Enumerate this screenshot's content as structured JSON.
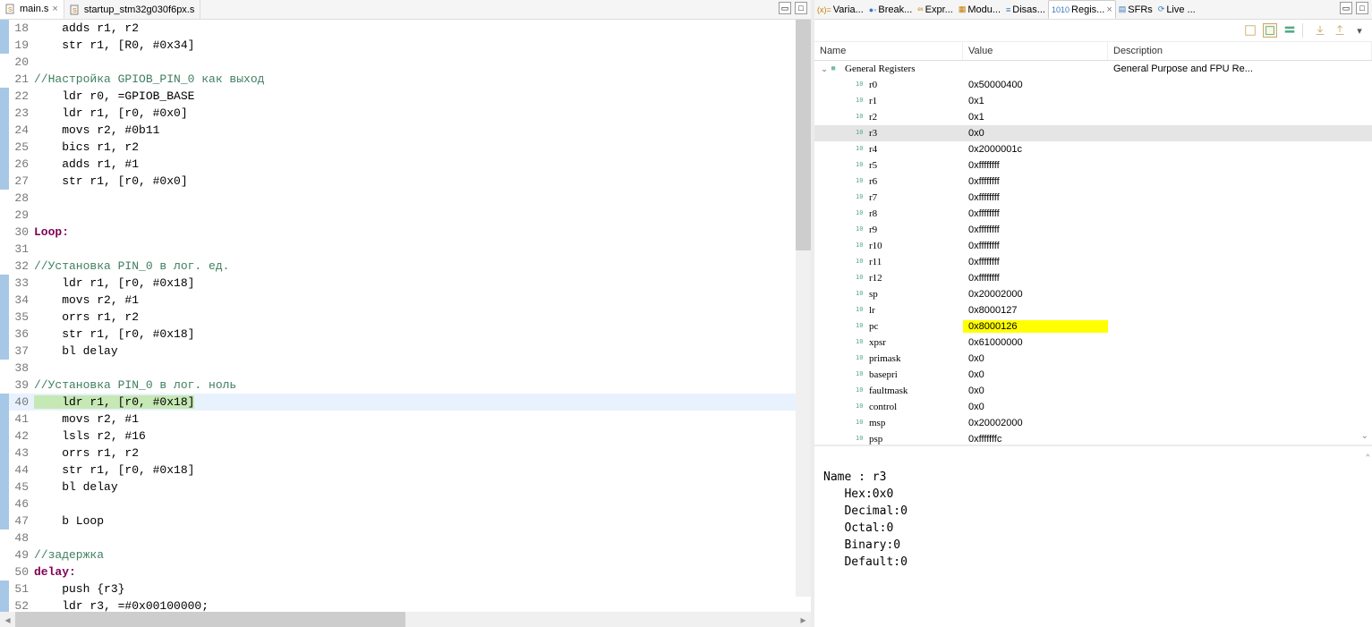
{
  "editor": {
    "tabs": [
      {
        "label": "main.s",
        "active": true
      },
      {
        "label": "startup_stm32g030f6px.s",
        "active": false
      }
    ],
    "lines": [
      {
        "n": 18,
        "bar": true,
        "type": "code",
        "text": "    adds r1, r2"
      },
      {
        "n": 19,
        "bar": true,
        "type": "code",
        "text": "    str r1, [R0, #0x34]"
      },
      {
        "n": 20,
        "bar": false,
        "type": "blank",
        "text": ""
      },
      {
        "n": 21,
        "bar": false,
        "type": "comment",
        "text": "//Настройка GPIOB_PIN_0 как выход"
      },
      {
        "n": 22,
        "bar": true,
        "type": "code",
        "text": "    ldr r0, =GPIOB_BASE"
      },
      {
        "n": 23,
        "bar": true,
        "type": "code",
        "text": "    ldr r1, [r0, #0x0]"
      },
      {
        "n": 24,
        "bar": true,
        "type": "code",
        "text": "    movs r2, #0b11"
      },
      {
        "n": 25,
        "bar": true,
        "type": "code",
        "text": "    bics r1, r2"
      },
      {
        "n": 26,
        "bar": true,
        "type": "code",
        "text": "    adds r1, #1"
      },
      {
        "n": 27,
        "bar": true,
        "type": "code",
        "text": "    str r1, [r0, #0x0]"
      },
      {
        "n": 28,
        "bar": false,
        "type": "blank",
        "text": ""
      },
      {
        "n": 29,
        "bar": false,
        "type": "blank",
        "text": ""
      },
      {
        "n": 30,
        "bar": false,
        "type": "label",
        "text": "Loop:"
      },
      {
        "n": 31,
        "bar": false,
        "type": "blank",
        "text": ""
      },
      {
        "n": 32,
        "bar": false,
        "type": "comment",
        "text": "//Установка PIN_0 в лог. ед."
      },
      {
        "n": 33,
        "bar": true,
        "type": "code",
        "text": "    ldr r1, [r0, #0x18]"
      },
      {
        "n": 34,
        "bar": true,
        "type": "code",
        "text": "    movs r2, #1"
      },
      {
        "n": 35,
        "bar": true,
        "type": "code",
        "text": "    orrs r1, r2"
      },
      {
        "n": 36,
        "bar": true,
        "type": "code",
        "text": "    str r1, [r0, #0x18]"
      },
      {
        "n": 37,
        "bar": true,
        "type": "code",
        "text": "    bl delay"
      },
      {
        "n": 38,
        "bar": false,
        "type": "blank",
        "text": ""
      },
      {
        "n": 39,
        "bar": false,
        "type": "comment",
        "text": "//Установка PIN_0 в лог. ноль"
      },
      {
        "n": 40,
        "bar": true,
        "type": "code",
        "text": "    ldr r1, [r0, #0x18]",
        "current": true
      },
      {
        "n": 41,
        "bar": true,
        "type": "code",
        "text": "    movs r2, #1"
      },
      {
        "n": 42,
        "bar": true,
        "type": "code",
        "text": "    lsls r2, #16"
      },
      {
        "n": 43,
        "bar": true,
        "type": "code",
        "text": "    orrs r1, r2"
      },
      {
        "n": 44,
        "bar": true,
        "type": "code",
        "text": "    str r1, [r0, #0x18]"
      },
      {
        "n": 45,
        "bar": true,
        "type": "code",
        "text": "    bl delay"
      },
      {
        "n": 46,
        "bar": true,
        "type": "blank",
        "text": ""
      },
      {
        "n": 47,
        "bar": true,
        "type": "code",
        "text": "    b Loop"
      },
      {
        "n": 48,
        "bar": false,
        "type": "blank",
        "text": ""
      },
      {
        "n": 49,
        "bar": false,
        "type": "comment",
        "text": "//задержка"
      },
      {
        "n": 50,
        "bar": false,
        "type": "label",
        "text": "delay:"
      },
      {
        "n": 51,
        "bar": true,
        "type": "code",
        "text": "    push {r3}"
      },
      {
        "n": 52,
        "bar": true,
        "type": "code",
        "text": "    ldr r3, =#0x00100000;"
      }
    ]
  },
  "views": {
    "tabs": [
      {
        "label": "Varia...",
        "icon": "var",
        "color": "#c77d00"
      },
      {
        "label": "Break...",
        "icon": "brk",
        "color": "#3a7abd"
      },
      {
        "label": "Expr...",
        "icon": "expr",
        "color": "#c77d00"
      },
      {
        "label": "Modu...",
        "icon": "mod",
        "color": "#c77d00"
      },
      {
        "label": "Disas...",
        "icon": "dis",
        "color": "#3a7abd"
      },
      {
        "label": "Regis...",
        "icon": "reg",
        "color": "#3a7abd",
        "active": true
      },
      {
        "label": "SFRs",
        "icon": "sfr",
        "color": "#3a7abd"
      },
      {
        "label": "Live ...",
        "icon": "live",
        "color": "#3a7abd"
      }
    ]
  },
  "registers": {
    "headers": {
      "name": "Name",
      "value": "Value",
      "desc": "Description"
    },
    "group": {
      "label": "General Registers",
      "desc": "General Purpose and FPU Re..."
    },
    "rows": [
      {
        "name": "r0",
        "value": "0x50000400"
      },
      {
        "name": "r1",
        "value": "0x1"
      },
      {
        "name": "r2",
        "value": "0x1"
      },
      {
        "name": "r3",
        "value": "0x0",
        "selected": true
      },
      {
        "name": "r4",
        "value": "0x2000001c"
      },
      {
        "name": "r5",
        "value": "0xffffffff"
      },
      {
        "name": "r6",
        "value": "0xffffffff"
      },
      {
        "name": "r7",
        "value": "0xffffffff"
      },
      {
        "name": "r8",
        "value": "0xffffffff"
      },
      {
        "name": "r9",
        "value": "0xffffffff"
      },
      {
        "name": "r10",
        "value": "0xffffffff"
      },
      {
        "name": "r11",
        "value": "0xffffffff"
      },
      {
        "name": "r12",
        "value": "0xffffffff"
      },
      {
        "name": "sp",
        "value": "0x20002000"
      },
      {
        "name": "lr",
        "value": "0x8000127"
      },
      {
        "name": "pc",
        "value": "0x8000126",
        "highlight": true
      },
      {
        "name": "xpsr",
        "value": "0x61000000"
      },
      {
        "name": "primask",
        "value": "0x0"
      },
      {
        "name": "basepri",
        "value": "0x0"
      },
      {
        "name": "faultmask",
        "value": "0x0"
      },
      {
        "name": "control",
        "value": "0x0"
      },
      {
        "name": "msp",
        "value": "0x20002000"
      },
      {
        "name": "psp",
        "value": "0xfffffffc"
      }
    ]
  },
  "detail": {
    "name_label": "Name : ",
    "name": "r3",
    "lines": [
      "   Hex:0x0",
      "   Decimal:0",
      "   Octal:0",
      "   Binary:0",
      "   Default:0"
    ]
  }
}
